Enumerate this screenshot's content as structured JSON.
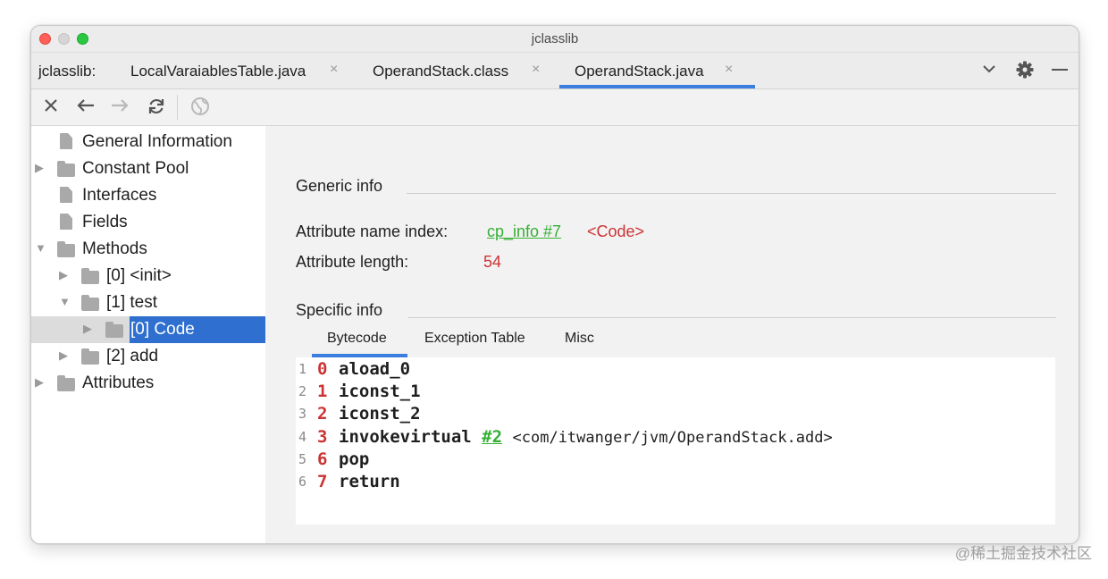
{
  "window": {
    "title": "jclasslib"
  },
  "tabs": {
    "prefix": "jclasslib:",
    "items": [
      {
        "label": "LocalVaraiablesTable.java"
      },
      {
        "label": "OperandStack.class"
      },
      {
        "label": "OperandStack.java",
        "active": true
      }
    ],
    "close_glyph": "×"
  },
  "toolbar": {
    "close_icon": "close-icon",
    "back_icon": "arrow-left-icon",
    "forward_icon": "arrow-right-icon",
    "refresh_icon": "refresh-icon",
    "web_icon": "globe-icon"
  },
  "tree": {
    "items": [
      {
        "label": "General Information"
      },
      {
        "label": "Constant Pool"
      },
      {
        "label": "Interfaces"
      },
      {
        "label": "Fields"
      },
      {
        "label": "Methods"
      },
      {
        "label": "[0] <init>"
      },
      {
        "label": "[1] test"
      },
      {
        "label": "[0] Code",
        "selected": true
      },
      {
        "label": "[2] add"
      },
      {
        "label": "Attributes"
      }
    ]
  },
  "details": {
    "generic_title": "Generic info",
    "name_index_label": "Attribute name index:",
    "name_index_link": "cp_info #7",
    "name_index_value": "<Code>",
    "length_label": "Attribute length:",
    "length_value": "54",
    "specific_title": "Specific info",
    "subtabs": [
      "Bytecode",
      "Exception Table",
      "Misc"
    ]
  },
  "bytecode": [
    {
      "line": "1",
      "offset": "0",
      "instr": "aload_0"
    },
    {
      "line": "2",
      "offset": "1",
      "instr": "iconst_1"
    },
    {
      "line": "3",
      "offset": "2",
      "instr": "iconst_2"
    },
    {
      "line": "4",
      "offset": "3",
      "instr": "invokevirtual",
      "ref": "#2",
      "comment": "<com/itwanger/jvm/OperandStack.add>"
    },
    {
      "line": "5",
      "offset": "6",
      "instr": "pop"
    },
    {
      "line": "6",
      "offset": "7",
      "instr": "return"
    }
  ],
  "watermark": "@稀土掘金技术社区",
  "colors": {
    "accent": "#3c7ee0",
    "selection": "#2e6fd0",
    "link_green": "#35b035",
    "value_red": "#cc3333"
  }
}
